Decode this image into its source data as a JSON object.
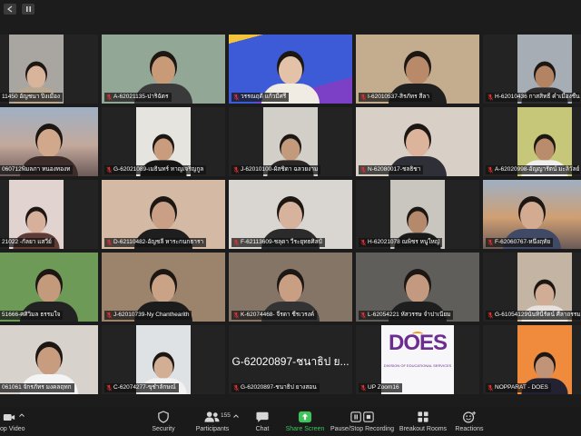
{
  "topbar": {
    "controls": [
      {
        "icon": "exit-fullscreen-icon"
      },
      {
        "icon": "pause-icon"
      }
    ]
  },
  "gallery": {
    "active_speaker_color": "#b5d23a",
    "tiles": [
      {
        "name": "11450 อัญชนา ปิงเมือง",
        "frame": "portrait",
        "bg": "#a9a6a1",
        "skin": "#d8b49a",
        "shirt": "#b8a88f",
        "mic_icon": null
      },
      {
        "name": "A-62021135-ปาริฉัตร",
        "frame": "full",
        "bg": "#92a796",
        "skin": "#c99a78",
        "shirt": "#3a3a3a",
        "mic_icon": "mic-muted-icon"
      },
      {
        "name": "วรรณฤดี แก้วมีศรี",
        "frame": "full",
        "bg": "#3d5bd6",
        "skin": "#e3c2a8",
        "shirt": "#f0ece3",
        "mic_icon": "mic-muted-icon",
        "active_speaker": true
      },
      {
        "name": "I-62010537-สิรภัทร สีลา",
        "frame": "full",
        "bg": "#c4ad8e",
        "skin": "#b98a6a",
        "shirt": "#1f1f1f",
        "mic_icon": "mic-muted-icon"
      },
      {
        "name": "H-62010436 กาสสิทธิ์ คำเมืองชื่น",
        "frame": "portrait",
        "bg": "#a6adb4",
        "skin": "#b28464",
        "shirt": "#2d2d2d",
        "mic_icon": "mic-muted-icon"
      },
      {
        "name": "060712พิมลภา หนองทองท",
        "frame": "full",
        "bg": "#c3a99c",
        "skin": "#d2a88c",
        "shirt": "#3b2c29",
        "mic_icon": null
      },
      {
        "name": "G-62021089-เมธินทร์ หาญเจริญกูล",
        "frame": "portrait",
        "bg": "#e6e4df",
        "skin": "#c99c7e",
        "shirt": "#151515",
        "mic_icon": "mic-muted-icon"
      },
      {
        "name": "J-62010100-ผัสชิดา ฉลวยงาม",
        "frame": "portrait",
        "bg": "#d2cec8",
        "skin": "#c49a7c",
        "shirt": "#2a2626",
        "mic_icon": "mic-muted-icon"
      },
      {
        "name": "N-62080017-ชลธิชา",
        "frame": "full",
        "bg": "#d8cfc7",
        "skin": "#dcb49c",
        "shirt": "#2f2f38",
        "mic_icon": "mic-muted-icon"
      },
      {
        "name": "A-62020998-อัญญารัตน์ มะลิวัลย์",
        "frame": "portrait",
        "bg": "#c7c77a",
        "skin": "#b98c6c",
        "shirt": "#efefef",
        "mic_icon": "mic-muted-icon"
      },
      {
        "name": "21022 -กัลยา แสวีย์",
        "frame": "portrait",
        "bg": "#e0d3d0",
        "skin": "#d6b09a",
        "shirt": "#5e3b34",
        "mic_icon": null
      },
      {
        "name": "D-62110482-อัญชลี หาระกนกธารา",
        "frame": "full",
        "bg": "#d4b9a5",
        "skin": "#c9a085",
        "shirt": "#1e1e1e",
        "mic_icon": "mic-muted-icon"
      },
      {
        "name": "F-62113609-ชลุดา วีระยุทธศิลป์",
        "frame": "full",
        "bg": "#d9d6d1",
        "skin": "#d7b29c",
        "shirt": "#2b2b2b",
        "mic_icon": "mic-muted-icon"
      },
      {
        "name": "H-62021078 ณพิชร หนูใหญ่",
        "frame": "portrait",
        "bg": "#c9c6c0",
        "skin": "#b5896c",
        "shirt": "#1a1a1a",
        "mic_icon": "mic-muted-icon"
      },
      {
        "name": "F-62060767-หนึ่งฤทัย",
        "frame": "full",
        "bg": "#cf9f72",
        "skin": "#d2ab90",
        "shirt": "#404a66",
        "mic_icon": "mic-muted-icon"
      },
      {
        "name": "51666-ศศิวิมล ธรรมใจ",
        "frame": "full",
        "bg": "#6e9a57",
        "skin": "#c49a7d",
        "shirt": "#222222",
        "mic_icon": null
      },
      {
        "name": "J-62010739-Ny Chanthearith",
        "frame": "full",
        "bg": "#9c836b",
        "skin": "#caa286",
        "shirt": "#1c1c1c",
        "mic_icon": "mic-muted-icon"
      },
      {
        "name": "K-62074468- จีรดา ชีรเวรงค์",
        "frame": "full",
        "bg": "#857567",
        "skin": "#c99f83",
        "shirt": "#333333",
        "mic_icon": "mic-muted-icon"
      },
      {
        "name": "L-62054221 หัสวรรษ จำปาเนียม",
        "frame": "full",
        "bg": "#5f5e5b",
        "skin": "#c39a7f",
        "shirt": "#1e1e1e",
        "mic_icon": "mic-muted-icon"
      },
      {
        "name": "G-61054129นันทินีรัตน์ ศีลาถรรมยุต",
        "frame": "portrait",
        "bg": "#c3b4a3",
        "skin": "#d1ad95",
        "shirt": "#e6e1dc",
        "mic_icon": "mic-muted-icon"
      },
      {
        "name": "061061 จักรภัทร มงคลฤทก",
        "frame": "full",
        "bg": "#d7d2cb",
        "skin": "#c79c7f",
        "shirt": "#f4f4f4",
        "mic_icon": null
      },
      {
        "name": "C-62074277-ขุชำลักษณ์",
        "frame": "portrait",
        "bg": "#dfe2e5",
        "skin": "#d2ae95",
        "shirt": "#f2f2f2",
        "mic_icon": "mic-muted-icon"
      },
      {
        "name": "G-62020897-ชนาธิป ยางสอน",
        "frame": "none",
        "display_name": "G-62020897-ชนาธิป ย...",
        "mic_icon": "mic-muted-icon"
      },
      {
        "name": "UP Zoom16",
        "frame": "logo",
        "logo_text": "DOES",
        "logo_subtitle": "DIVISION OF EDUCATIONAL SERVICES",
        "logo_colors": {
          "primary": "#6b2d90",
          "accent": "#f29a1f"
        },
        "mic_icon": "mic-muted-icon"
      },
      {
        "name": "NOPPARAT - DOES",
        "frame": "portrait",
        "bg": "#f08a3c",
        "skin": "#c29477",
        "shirt": "#222233",
        "mic_icon": "mic-muted-icon"
      }
    ]
  },
  "toolbar": {
    "video": {
      "label": "op Video",
      "icon": "video-camera-icon"
    },
    "security": {
      "label": "Security",
      "icon": "shield-icon"
    },
    "participants": {
      "label": "Participants",
      "count": "155",
      "icon": "participants-icon"
    },
    "chat": {
      "label": "Chat",
      "icon": "chat-icon"
    },
    "share_screen": {
      "label": "Share Screen",
      "icon": "share-screen-icon",
      "color": "#3ec45a"
    },
    "recording": {
      "label": "Pause/Stop Recording",
      "icon": "pause-stop-recording-icon"
    },
    "breakout": {
      "label": "Breakout Rooms",
      "icon": "breakout-rooms-icon"
    },
    "reactions": {
      "label": "Reactions",
      "icon": "reactions-icon"
    }
  }
}
